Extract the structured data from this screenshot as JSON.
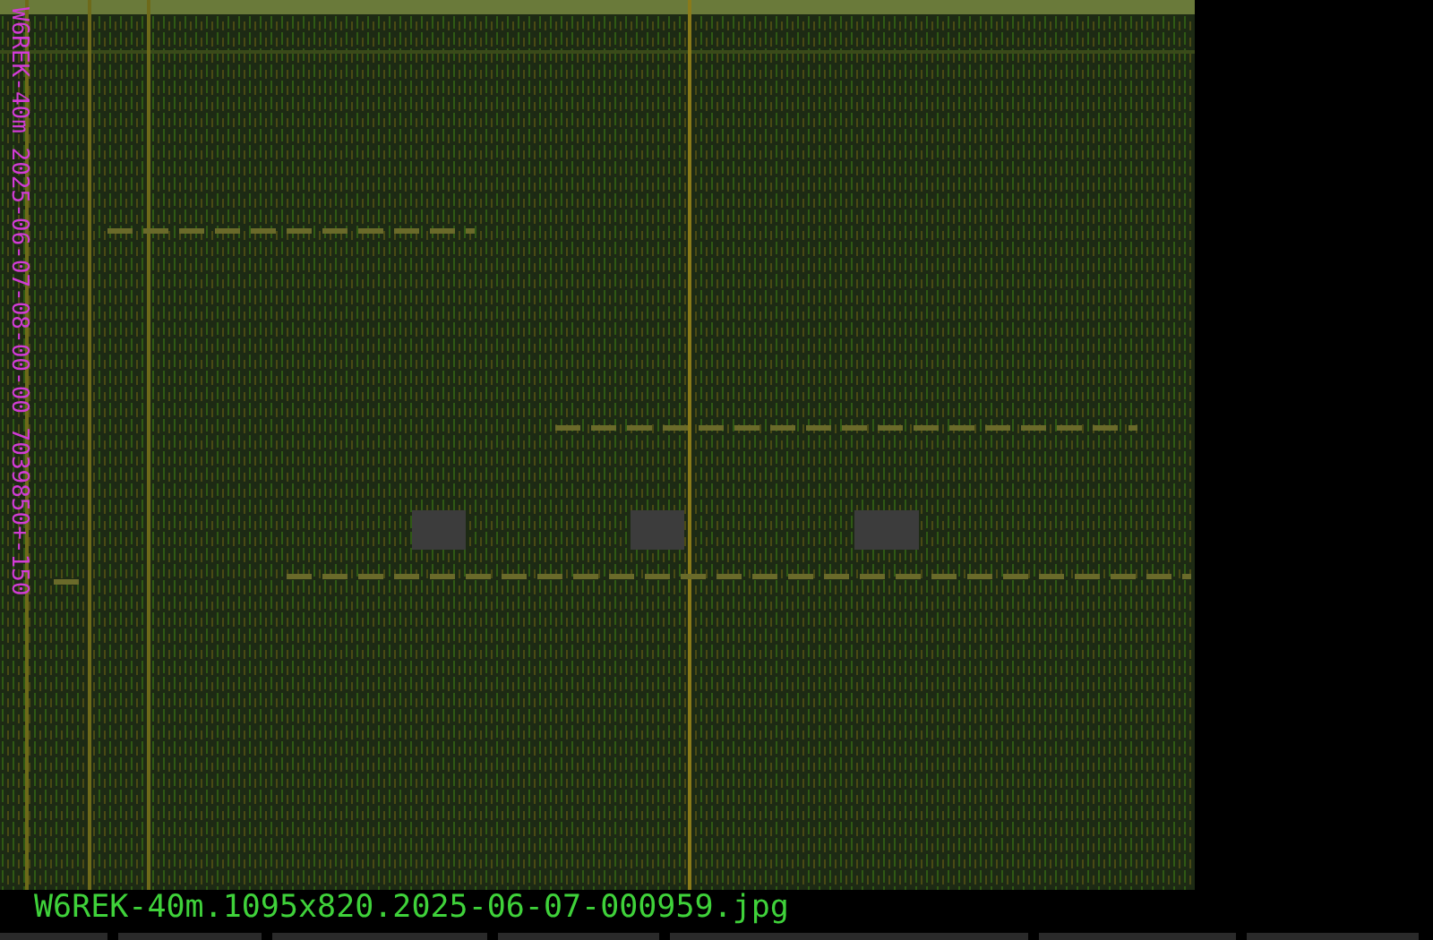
{
  "waterfall": {
    "side_label": "W6REK-40m 2025-06-07-08-00-00 7039850+-150"
  },
  "caption": "W6REK-40m.1095x820.2025-06-07-000959.jpg"
}
